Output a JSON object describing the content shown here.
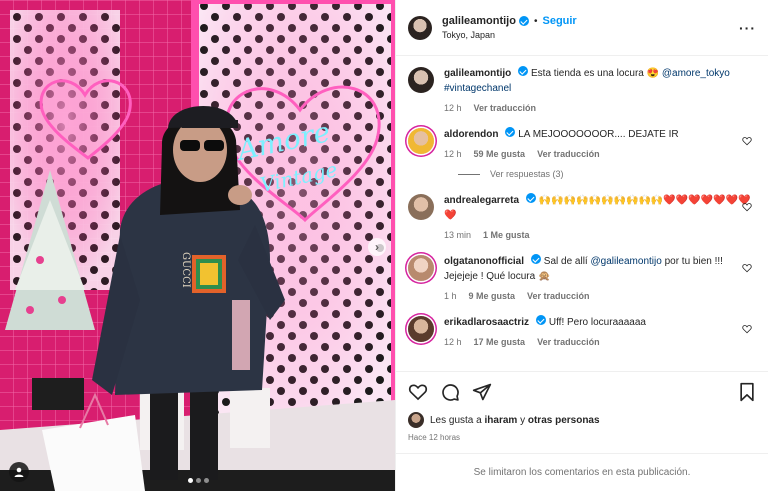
{
  "post": {
    "username": "galileamontijo",
    "follow_label": "Seguir",
    "separator": "•",
    "location": "Tokyo, Japan",
    "more_label": "···",
    "caption": {
      "text": "Esta tienda es una locura 😍",
      "mention": "@amore_tokyo",
      "hashtag": "#vintagechanel",
      "time": "12 h",
      "translate": "Ver traducción"
    }
  },
  "comments": [
    {
      "username": "aldorendon",
      "text": "LA MEJOOOOOOOR.... DEJATE IR",
      "time": "12 h",
      "likes": "59 Me gusta",
      "translate": "Ver traducción",
      "replies": "Ver respuestas (3)"
    },
    {
      "username": "andrealegarreta",
      "text": "🙌🙌🙌🙌🙌🙌🙌🙌🙌🙌❤️❤️❤️❤️❤️❤️❤️❤️",
      "time": "13 min",
      "likes": "1 Me gusta"
    },
    {
      "username": "olgatanonofficial",
      "text_before": "Sal de allí",
      "mention": "@galileamontijo",
      "text_after": "por tu bien !!! Jejejeje ! Qué locura 🙊",
      "time": "1 h",
      "likes": "9 Me gusta",
      "translate": "Ver traducción"
    },
    {
      "username": "erikadlarosaactriz",
      "text": "Uff! Pero locuraaaaaa",
      "time": "12 h",
      "likes": "17 Me gusta",
      "translate": "Ver traducción"
    }
  ],
  "likes_line": {
    "prefix": "Les gusta a",
    "user": "iharam",
    "middle": "y",
    "rest": "otras personas"
  },
  "posted_ago": "Hace 12 horas",
  "comments_limited": "Se limitaron los comentarios en esta publicación.",
  "photo": {
    "next_icon": "›",
    "neon_sign": "Amore Vintage"
  },
  "colors": {
    "accent": "#0095f6",
    "mention": "#00376b",
    "neon_pink": "#ff3fa4",
    "neon_blue": "#6ee6ff",
    "wall_pink": "#e02a7d"
  }
}
